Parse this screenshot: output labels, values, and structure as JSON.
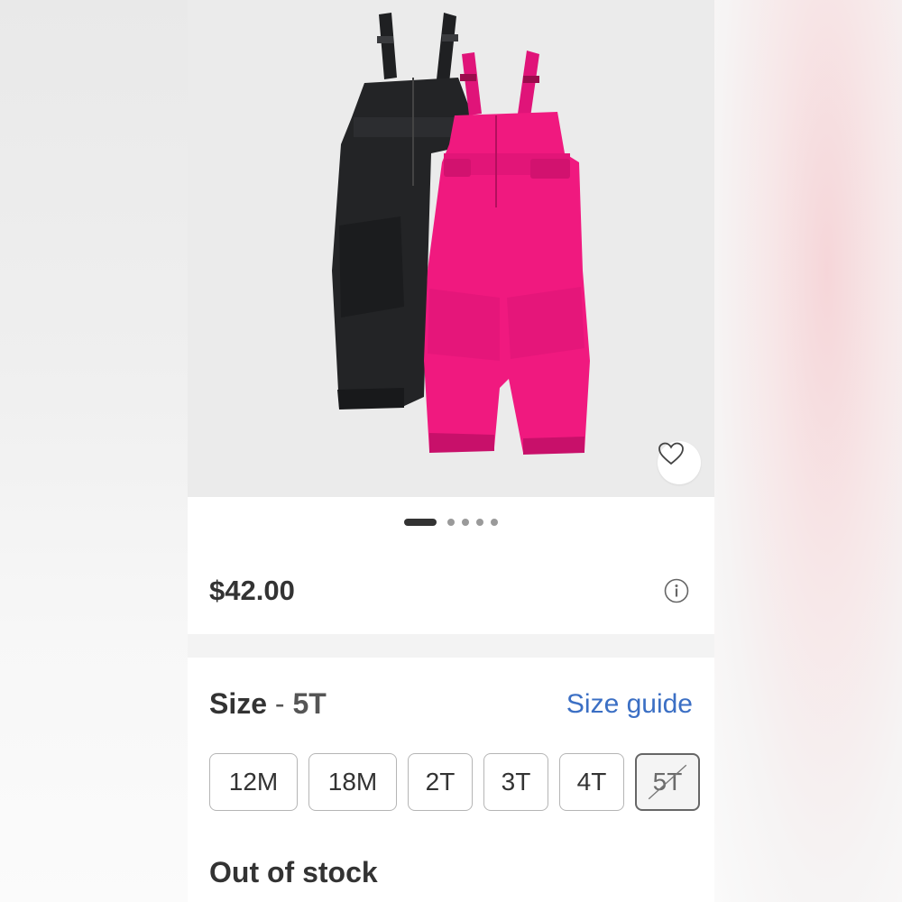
{
  "product": {
    "image_alt": "Black and pink kids snow bib overalls",
    "carousel": {
      "total": 5,
      "active_index": 0
    },
    "price": "$42.00"
  },
  "size": {
    "label": "Size",
    "separator": "-",
    "selected_value": "5T",
    "guide_label": "Size guide",
    "options": [
      "12M",
      "18M",
      "2T",
      "3T",
      "4T",
      "5T"
    ]
  },
  "availability": {
    "status": "Out of stock"
  },
  "icons": {
    "favorite": "heart-icon",
    "price_info": "info-icon"
  },
  "colors": {
    "link": "#3b6fc4",
    "text": "#333333",
    "bib_pink": "#f0197f",
    "bib_black": "#232426"
  }
}
